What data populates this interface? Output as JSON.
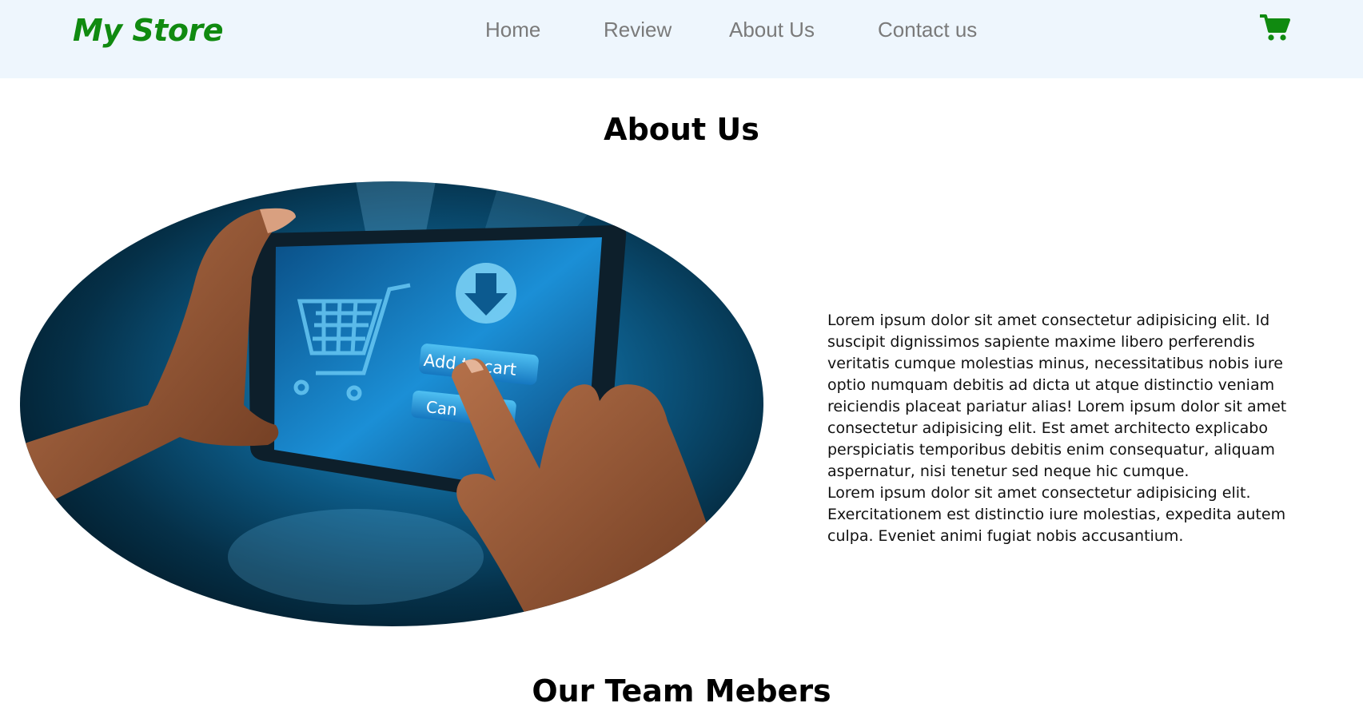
{
  "navbar": {
    "brand": "My Store",
    "links": [
      "Home",
      "Review",
      "About Us",
      "Contact us"
    ],
    "cart_icon": "shopping-cart-icon",
    "brand_color": "#108a10",
    "background": "#eef6fd"
  },
  "about": {
    "title": "About Us",
    "paragraph_1": "Lorem ipsum dolor sit amet consectetur adipisicing elit. Id suscipit dignissimos sapiente maxime libero perferendis veritatis cumque molestias minus, necessitatibus nobis iure optio numquam debitis ad dicta ut atque distinctio veniam reiciendis placeat pariatur alias! Lorem ipsum dolor sit amet consectetur adipisicing elit. Est amet architecto explicabo perspiciatis temporibus debitis enim consequatur, aliquam aspernatur, nisi tenetur sed neque hic cumque.",
    "paragraph_2": "Lorem ipsum dolor sit amet consectetur adipisicing elit. Exercitationem est distinctio iure molestias, expedita autem culpa. Eveniet animi fugiat nobis accusantium.",
    "image": {
      "add_to_cart_label": "Add to cart",
      "cancel_label": "Can"
    }
  },
  "team": {
    "title": "Our Team Mebers"
  }
}
